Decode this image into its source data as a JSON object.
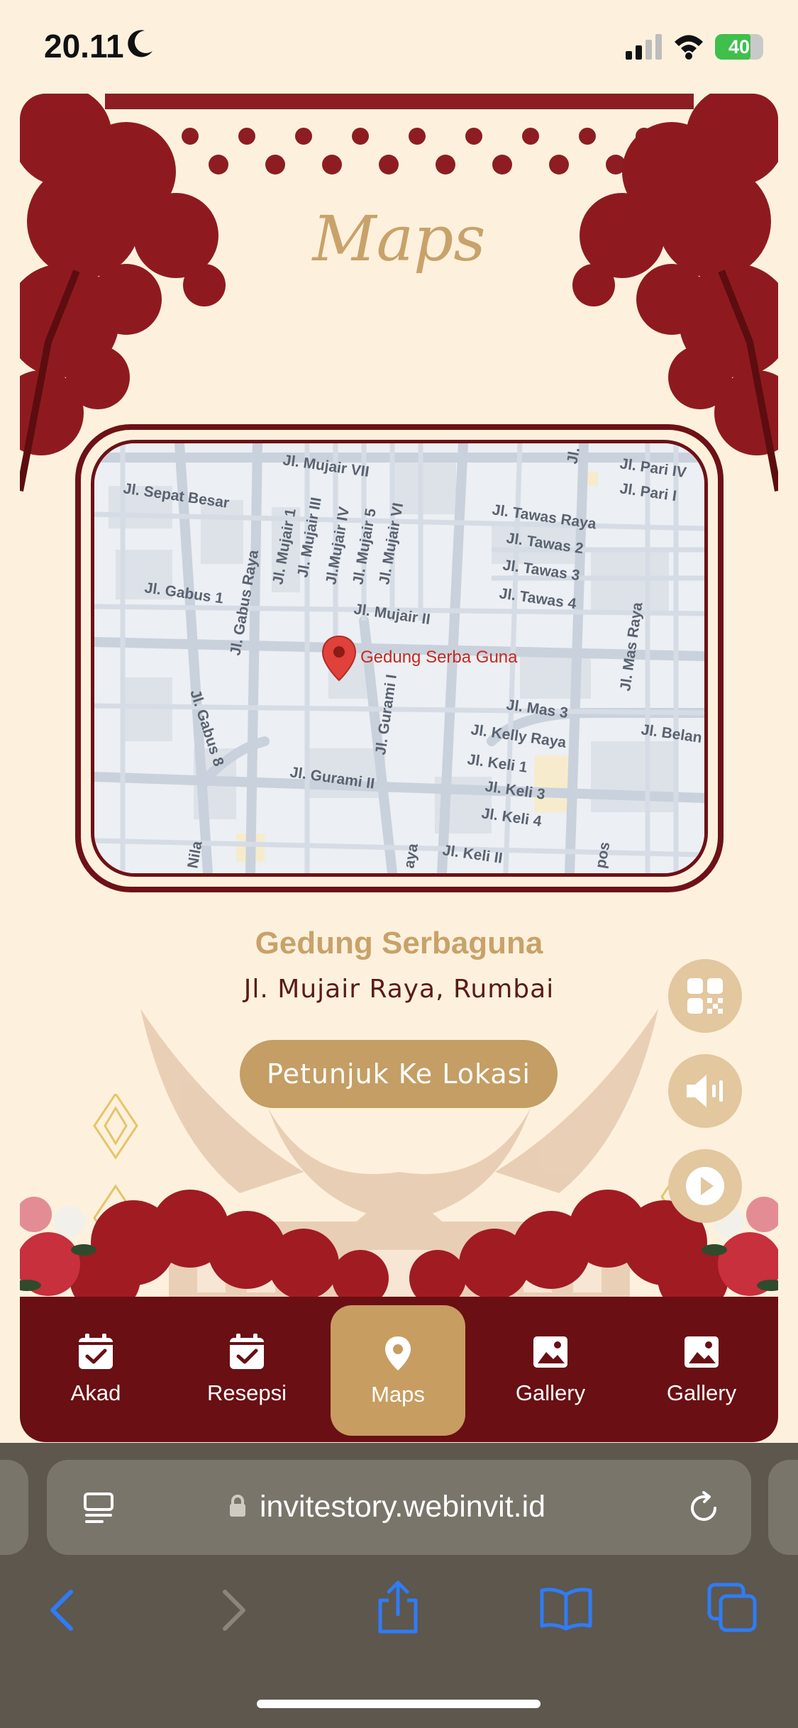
{
  "status_bar": {
    "time": "20.11",
    "battery": "40",
    "battery_level": 0.4
  },
  "section": {
    "title": "Maps"
  },
  "map": {
    "pin_label": "Gedung Serba Guna",
    "streets": [
      "Jl. Mujair VII",
      "Jl. Sepat Besar",
      "Jl. Pari IV",
      "Jl. Pari I",
      "Jl. Tawas Raya",
      "Jl. Tawas 2",
      "Jl. Tawas 3",
      "Jl. Tawas 4",
      "Jl. Gabus 1",
      "Jl. Gabus Raya",
      "Jl. Mujair 1",
      "Jl. Mujair III",
      "Jl.Mujair IV",
      "Jl. Mujair 5",
      "Jl. Mujair VI",
      "Jl. Mujair II",
      "Jl. Mas Raya",
      "Jl. Gurami I",
      "Jl. Mas 3",
      "Jl. Kelly Raya",
      "Jl. Belan",
      "Jl. Gabus 8",
      "Jl. Keli 1",
      "Jl. Gurami II",
      "Jl. Keli 3",
      "Jl. Keli 4",
      "Jl. Keli II",
      "Nila",
      "Jl. Ba",
      "aya",
      "pos"
    ]
  },
  "venue": {
    "name": "Gedung Serbaguna",
    "address": "Jl. Mujair Raya, Rumbai",
    "directions_label": "Petunjuk Ke Lokasi"
  },
  "nav": {
    "items": [
      {
        "label": "Akad",
        "icon": "calendar-check-icon"
      },
      {
        "label": "Resepsi",
        "icon": "calendar-check-icon"
      },
      {
        "label": "Maps",
        "icon": "location-pin-icon"
      },
      {
        "label": "Gallery",
        "icon": "image-icon"
      },
      {
        "label": "Gallery",
        "icon": "image-icon"
      }
    ],
    "active_index": 2
  },
  "browser": {
    "url": "invitestory.webinvit.id"
  },
  "colors": {
    "cream": "#fdf1dd",
    "maroon": "#6a0f13",
    "gold": "#c8a26a",
    "ios_blue": "#2f7cf6"
  }
}
